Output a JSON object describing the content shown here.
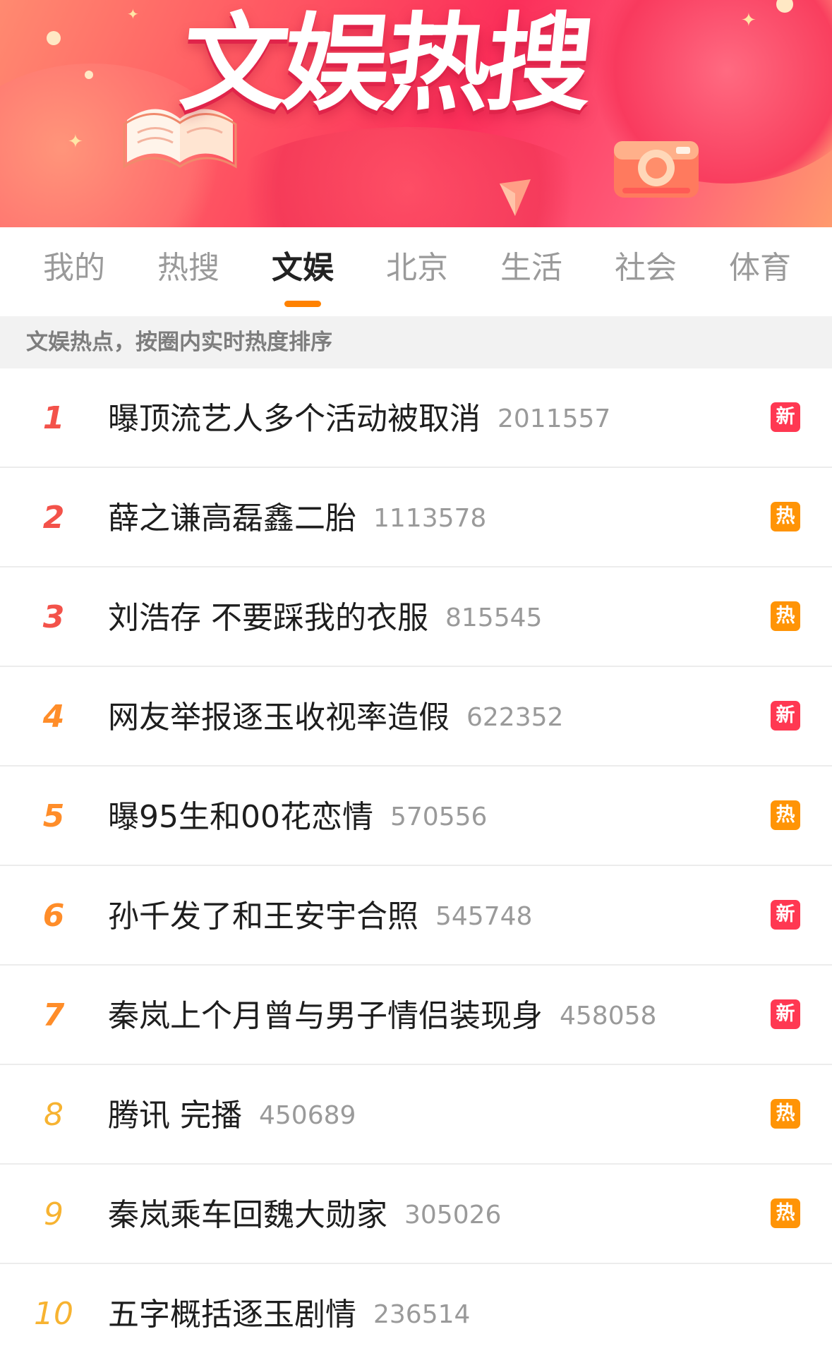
{
  "banner": {
    "title": "文娱热搜"
  },
  "tabs": [
    {
      "label": "我的",
      "active": false
    },
    {
      "label": "热搜",
      "active": false
    },
    {
      "label": "文娱",
      "active": true
    },
    {
      "label": "北京",
      "active": false
    },
    {
      "label": "生活",
      "active": false
    },
    {
      "label": "社会",
      "active": false
    },
    {
      "label": "体育",
      "active": false
    }
  ],
  "subheader": "文娱热点，按圈内实时热度排序",
  "colors": {
    "accent": "#ff8200",
    "badge_new": "#ff3852",
    "badge_hot": "#ff9406",
    "rank_top": "#f3524a",
    "rank_mid": "#ff8d29",
    "rank_low": "#f7b331"
  },
  "items": [
    {
      "rank": "1",
      "title": "曝顶流艺人多个活动被取消",
      "count": "2011557",
      "badge": "新",
      "badge_type": "new"
    },
    {
      "rank": "2",
      "title": "薛之谦高磊鑫二胎",
      "count": "1113578",
      "badge": "热",
      "badge_type": "hot"
    },
    {
      "rank": "3",
      "title": "刘浩存 不要踩我的衣服",
      "count": "815545",
      "badge": "热",
      "badge_type": "hot"
    },
    {
      "rank": "4",
      "title": "网友举报逐玉收视率造假",
      "count": "622352",
      "badge": "新",
      "badge_type": "new"
    },
    {
      "rank": "5",
      "title": "曝95生和00花恋情",
      "count": "570556",
      "badge": "热",
      "badge_type": "hot"
    },
    {
      "rank": "6",
      "title": "孙千发了和王安宇合照",
      "count": "545748",
      "badge": "新",
      "badge_type": "new"
    },
    {
      "rank": "7",
      "title": "秦岚上个月曾与男子情侣装现身",
      "count": "458058",
      "badge": "新",
      "badge_type": "new"
    },
    {
      "rank": "8",
      "title": "腾讯 完播",
      "count": "450689",
      "badge": "热",
      "badge_type": "hot"
    },
    {
      "rank": "9",
      "title": "秦岚乘车回魏大勋家",
      "count": "305026",
      "badge": "热",
      "badge_type": "hot"
    },
    {
      "rank": "10",
      "title": "五字概括逐玉剧情",
      "count": "236514",
      "badge": "",
      "badge_type": "none"
    }
  ]
}
